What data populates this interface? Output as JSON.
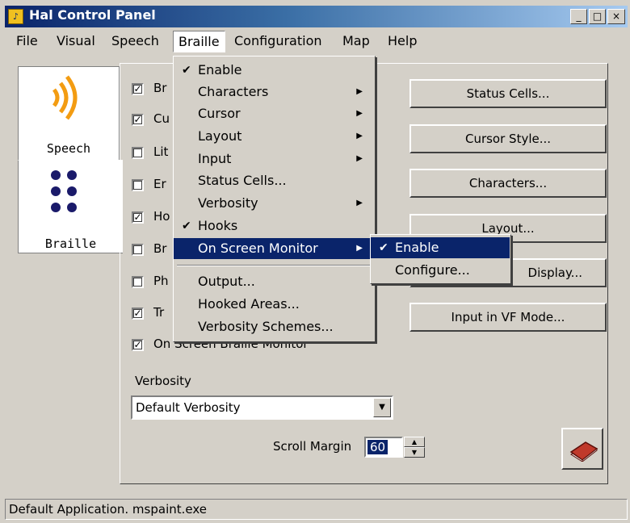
{
  "window": {
    "title": "Hal Control Panel"
  },
  "menubar": {
    "items": [
      {
        "label": "File"
      },
      {
        "label": "Visual"
      },
      {
        "label": "Speech"
      },
      {
        "label": "Braille"
      },
      {
        "label": "Configuration"
      },
      {
        "label": "Map"
      },
      {
        "label": "Help"
      }
    ]
  },
  "tabs": {
    "speech": "Speech",
    "braille": "Braille"
  },
  "checkboxes": [
    {
      "label": "Br",
      "checked": true
    },
    {
      "label": "Cu",
      "checked": true
    },
    {
      "label": "Lit",
      "checked": false
    },
    {
      "label": "Er",
      "checked": false
    },
    {
      "label": "Ho",
      "checked": true
    },
    {
      "label": "Br",
      "checked": false
    },
    {
      "label": "Ph",
      "checked": false
    },
    {
      "label": "Tr",
      "checked": true
    },
    {
      "label": "On Screen Braille Monitor",
      "checked": true
    }
  ],
  "buttons": [
    "Status Cells...",
    "Cursor Style...",
    "Characters...",
    "Layout...",
    "Display...",
    "Input in VF Mode..."
  ],
  "verbosity": {
    "label": "Verbosity",
    "selected": "Default Verbosity"
  },
  "scroll_margin": {
    "label": "Scroll Margin",
    "value": "60"
  },
  "braille_menu": [
    {
      "label": "Enable",
      "checked": true
    },
    {
      "label": "Characters",
      "submenu": true
    },
    {
      "label": "Cursor",
      "submenu": true
    },
    {
      "label": "Layout",
      "submenu": true
    },
    {
      "label": "Input",
      "submenu": true
    },
    {
      "label": "Status Cells..."
    },
    {
      "label": "Verbosity",
      "submenu": true
    },
    {
      "label": "Hooks",
      "checked": true
    },
    {
      "label": "On Screen Monitor",
      "submenu": true,
      "highlighted": true
    },
    {
      "label": "Output..."
    },
    {
      "label": "Hooked Areas..."
    },
    {
      "label": "Verbosity Schemes..."
    }
  ],
  "submenu": [
    {
      "label": "Enable",
      "checked": true,
      "highlighted": true
    },
    {
      "label": "Configure..."
    }
  ],
  "status_bar": "Default Application. mspaint.exe",
  "colors": {
    "highlight": "#0a246a",
    "face": "#d4d0c8"
  }
}
